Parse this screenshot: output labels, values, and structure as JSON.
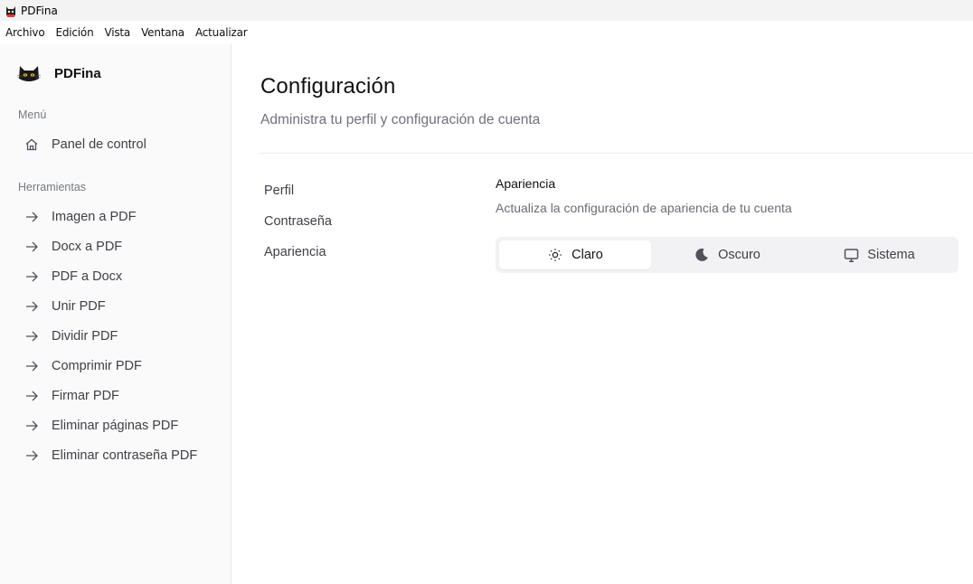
{
  "window": {
    "title": "PDFina"
  },
  "menubar": {
    "items": [
      "Archivo",
      "Edición",
      "Vista",
      "Ventana",
      "Actualizar"
    ]
  },
  "sidebar": {
    "brand": "PDFina",
    "menu_label": "Menú",
    "menu_items": [
      {
        "label": "Panel de control",
        "icon": "home-icon"
      }
    ],
    "tools_label": "Herramientas",
    "tools_items": [
      {
        "label": "Imagen a PDF",
        "icon": "arrow-right-icon"
      },
      {
        "label": "Docx a PDF",
        "icon": "arrow-right-icon"
      },
      {
        "label": "PDF a Docx",
        "icon": "arrow-right-icon"
      },
      {
        "label": "Unir PDF",
        "icon": "arrow-right-icon"
      },
      {
        "label": "Dividir PDF",
        "icon": "arrow-right-icon"
      },
      {
        "label": "Comprimir PDF",
        "icon": "arrow-right-icon"
      },
      {
        "label": "Firmar PDF",
        "icon": "arrow-right-icon"
      },
      {
        "label": "Eliminar páginas PDF",
        "icon": "arrow-right-icon"
      },
      {
        "label": "Eliminar contraseña PDF",
        "icon": "arrow-right-icon"
      }
    ]
  },
  "main": {
    "title": "Configuración",
    "subtitle": "Administra tu perfil y configuración de cuenta",
    "settings_nav": [
      "Perfil",
      "Contraseña",
      "Apariencia"
    ],
    "appearance": {
      "title": "Apariencia",
      "description": "Actualiza la configuración de apariencia de tu cuenta",
      "options": [
        {
          "label": "Claro",
          "icon": "sun-icon",
          "selected": true
        },
        {
          "label": "Oscuro",
          "icon": "moon-icon",
          "selected": false
        },
        {
          "label": "Sistema",
          "icon": "monitor-icon",
          "selected": false
        }
      ]
    }
  },
  "colors": {
    "sidebar_bg": "#fafafa",
    "text": "#3f3f46",
    "muted": "#70717a",
    "segment_bg": "#f2f2f4"
  }
}
